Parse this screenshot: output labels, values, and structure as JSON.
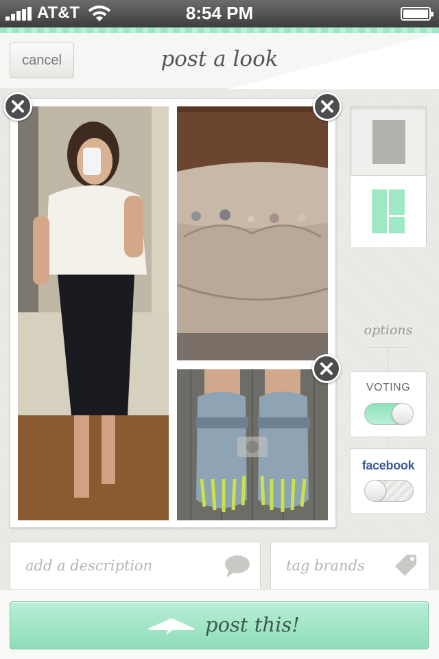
{
  "status_bar": {
    "carrier": "AT&T",
    "time": "8:54 PM"
  },
  "header": {
    "cancel_label": "cancel",
    "title": "post a look"
  },
  "collage": {
    "photos": [
      "person-in-mirror-photo",
      "clutch-bag-photo",
      "shoes-photo"
    ]
  },
  "options": {
    "label": "options",
    "voting": {
      "label": "VOTING",
      "enabled": true
    },
    "facebook": {
      "label": "facebook",
      "enabled": false
    }
  },
  "inputs": {
    "description_placeholder": "add a description",
    "brands_placeholder": "tag brands"
  },
  "actions": {
    "post_label": "post this!"
  },
  "colors": {
    "accent": "#9fe6c6",
    "facebook": "#3b5b98",
    "remove_button": "#4d4d4d"
  }
}
